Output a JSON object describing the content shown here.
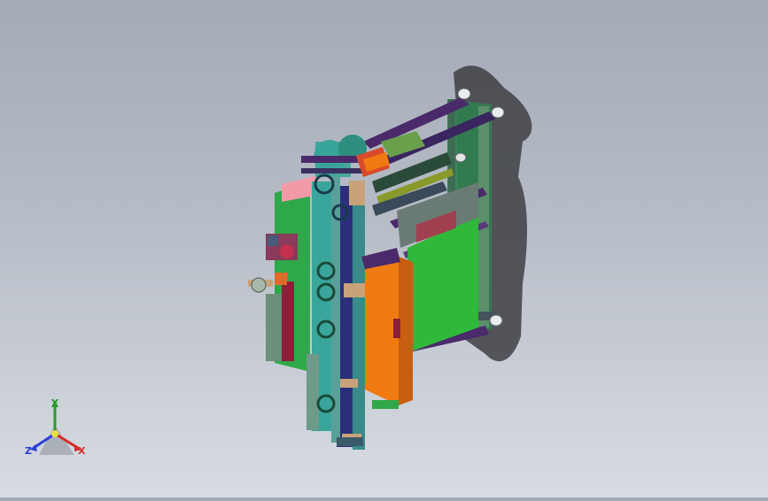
{
  "view": {
    "background_top": "#a3aab6",
    "background_bottom": "#d8dce2"
  },
  "triad": {
    "x_label": "X",
    "y_label": "Y",
    "z_label": "Z",
    "x_color": "#d82a2a",
    "y_color": "#2a9a2a",
    "z_color": "#2a3fd8"
  },
  "model": {
    "colors": {
      "frame_green": "#2f7f4f",
      "panel_green": "#2fb83a",
      "orange_panel": "#f07b12",
      "teal": "#3aa59a",
      "purple": "#4a2a6a",
      "navy": "#2b2f7a",
      "pink": "#f29aa8",
      "maroon": "#8a1f3a",
      "tan": "#c9a27a",
      "grey_green": "#6e8f7a"
    }
  }
}
